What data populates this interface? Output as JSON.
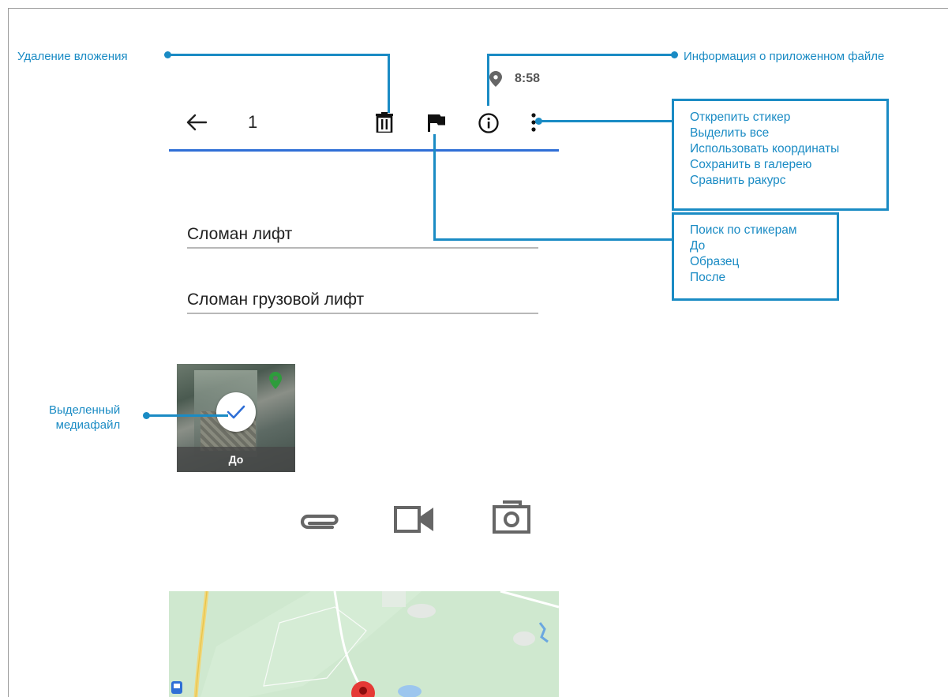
{
  "status_bar": {
    "time": "8:58",
    "location_icon": "location-pin-icon"
  },
  "toolbar": {
    "back_icon": "arrow-left-icon",
    "count": "1",
    "delete_icon": "trash-icon",
    "flag_icon": "flag-icon",
    "info_icon": "info-icon",
    "more_icon": "more-vertical-icon",
    "underline_color": "#2f6fd6"
  },
  "fields": [
    {
      "value": "Сломан лифт"
    },
    {
      "value": "Сломан грузовой лифт"
    }
  ],
  "media": {
    "thumbnail_label": "До",
    "selected": true,
    "location_icon": "green-location-pin-icon",
    "check_icon": "check-icon"
  },
  "attach_actions": [
    {
      "icon": "paperclip-icon"
    },
    {
      "icon": "video-camera-icon"
    },
    {
      "icon": "photo-camera-icon"
    }
  ],
  "annotations": {
    "delete_attachment": "Удаление вложения",
    "file_info": "Информация о приложенном файле",
    "selected_media_line1": "Выделенный",
    "selected_media_line2": "медиафайл"
  },
  "more_menu": [
    "Открепить стикер",
    "Выделить все",
    "Использовать координаты",
    "Сохранить в галерею",
    "Сравнить ракурс"
  ],
  "flag_menu": [
    "Поиск по стикерам",
    "До",
    "Образец",
    "После"
  ],
  "colors": {
    "callout": "#1a8bc4",
    "map_green": "#cfe8cf",
    "marker_red": "#e53935"
  }
}
